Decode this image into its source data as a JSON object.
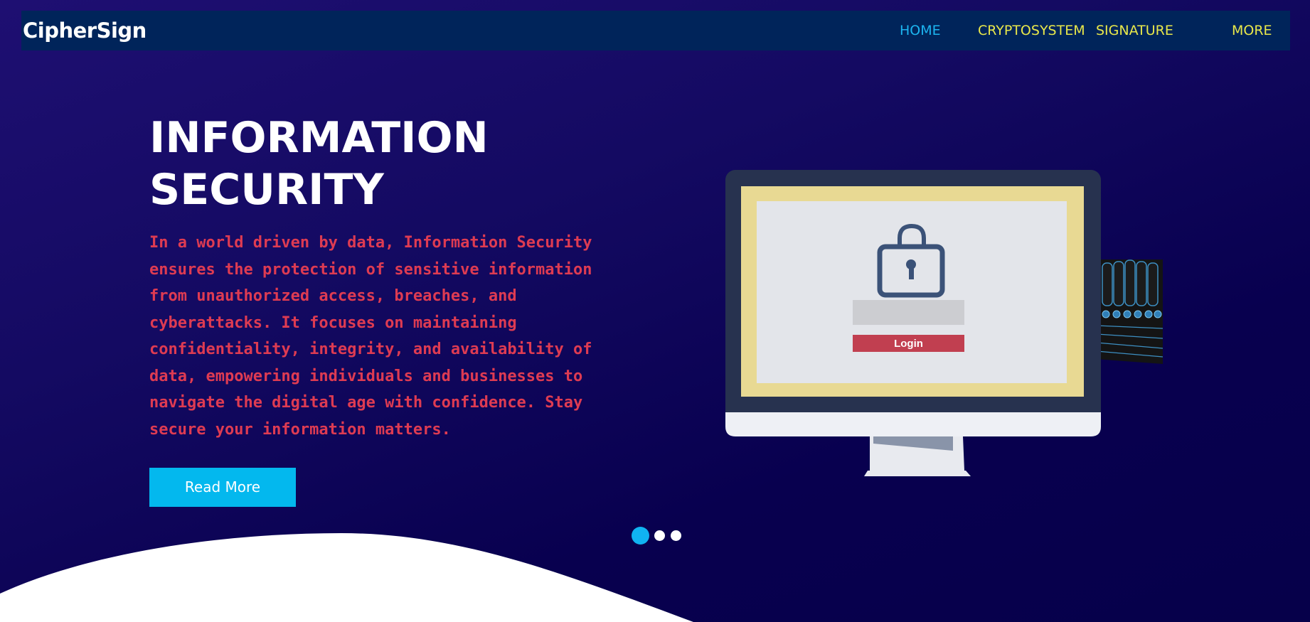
{
  "navbar": {
    "brand": "CipherSign",
    "items": [
      {
        "label": "HOME",
        "active": true
      },
      {
        "label": "CRYPTOSYSTEM",
        "active": false
      },
      {
        "label": "SIGNATURE",
        "active": false
      },
      {
        "label": "MORE",
        "active": false
      }
    ]
  },
  "hero": {
    "title_line1": "INFORMATION",
    "title_line2": "SECURITY",
    "description": "In a world driven by data, Information Security ensures the protection of sensitive information from unauthorized access, breaches, and cyberattacks. It focuses on maintaining confidentiality, integrity, and availability of data, empowering individuals and businesses to navigate the digital age with confidence. Stay secure your information matters.",
    "button_label": "Read More"
  },
  "illustration": {
    "login_label": "Login",
    "icons": [
      "monitor-icon",
      "lock-icon",
      "keyboard-icon"
    ]
  },
  "carousel": {
    "slides": 3,
    "active_index": 0
  },
  "colors": {
    "navbar_bg": "#00245a",
    "nav_link": "#e9e84a",
    "nav_active": "#1cb5f0",
    "hero_text": "#de3b52",
    "button_bg": "#03b8ee",
    "page_bg": "#140a62"
  }
}
